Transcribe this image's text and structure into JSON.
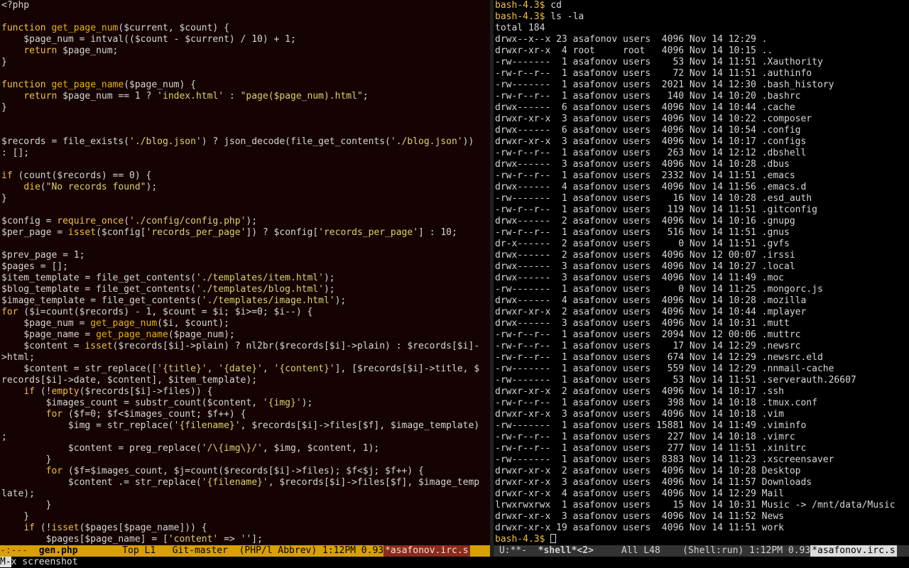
{
  "left_buffer": {
    "lines": [
      "<?php",
      "",
      "function get_page_num($current, $count) {",
      "    $page_num = intval(($count - $current) / 10) + 1;",
      "    return $page_num;",
      "}",
      "",
      "function get_page_name($page_num) {",
      "    return $page_num == 1 ? 'index.html' : \"page($page_num).html\";",
      "}",
      "",
      "",
      "$records = file_exists('./blog.json') ? json_decode(file_get_contents('./blog.json'))",
      ": [];",
      "",
      "if (count($records) == 0) {",
      "    die(\"No records found\");",
      "}",
      "",
      "$config = require_once('./config/config.php');",
      "$per_page = isset($config['records_per_page']) ? $config['records_per_page'] : 10;",
      "",
      "$prev_page = 1;",
      "$pages = [];",
      "$item_template = file_get_contents('./templates/item.html');",
      "$blog_template = file_get_contents('./templates/blog.html');",
      "$image_template = file_get_contents('./templates/image.html');",
      "for ($i=count($records) - 1, $count = $i; $i>=0; $i--) {",
      "    $page_num = get_page_num($i, $count);",
      "    $page_name = get_page_name($page_num);",
      "    $content = isset($records[$i]->plain) ? nl2br($records[$i]->plain) : $records[$i]-",
      ">html;",
      "    $content = str_replace(['{title}', '{date}', '{content}'], [$records[$i]->title, $",
      "records[$i]->date, $content], $item_template);",
      "    if (!empty($records[$i]->files)) {",
      "        $images_count = substr_count($content, '{img}');",
      "        for ($f=0; $f<$images_count; $f++) {",
      "            $img = str_replace('{filename}', $records[$i]->files[$f], $image_template)",
      ";",
      "            $content = preg_replace('/\\{img\\}/', $img, $content, 1);",
      "        }",
      "        for ($f=$images_count, $j=count($records[$i]->files); $f<$j; $f++) {",
      "            $content .= str_replace('{filename}', $records[$i]->files[$f], $image_temp",
      "late);",
      "        }",
      "    }",
      "    if (!isset($pages[$page_name])) {",
      "        $pages[$page_name] = ['content' => ''];"
    ]
  },
  "right_buffer": {
    "lines": [
      "bash-4.3$ cd",
      "bash-4.3$ ls -la",
      "total 184",
      "drwx--x--x 23 asafonov users  4096 Nov 14 12:29 .",
      "drwxr-xr-x  4 root     root   4096 Nov 14 10:15 ..",
      "-rw-------  1 asafonov users    53 Nov 14 11:51 .Xauthority",
      "-rw-r--r--  1 asafonov users    72 Nov 14 11:51 .authinfo",
      "-rw-------  1 asafonov users  2021 Nov 14 12:30 .bash_history",
      "-rw-r--r--  1 asafonov users   140 Nov 14 10:20 .bashrc",
      "drwx------  6 asafonov users  4096 Nov 14 10:44 .cache",
      "drwxr-xr-x  3 asafonov users  4096 Nov 14 10:22 .composer",
      "drwx------  6 asafonov users  4096 Nov 14 10:54 .config",
      "drwxr-xr-x  3 asafonov users  4096 Nov 14 10:17 .configs",
      "-rw-r--r--  1 asafonov users   263 Nov 14 12:12 .dbshell",
      "drwx------  3 asafonov users  4096 Nov 14 10:28 .dbus",
      "-rw-r--r--  1 asafonov users  2332 Nov 14 11:51 .emacs",
      "drwx------  4 asafonov users  4096 Nov 14 11:56 .emacs.d",
      "-rw-------  1 asafonov users    16 Nov 14 10:28 .esd_auth",
      "-rw-r--r--  1 asafonov users   119 Nov 14 11:51 .gitconfig",
      "drwx------  2 asafonov users  4096 Nov 14 10:16 .gnupg",
      "-rw-r--r--  1 asafonov users   516 Nov 14 11:51 .gnus",
      "dr-x------  2 asafonov users     0 Nov 14 11:51 .gvfs",
      "drwx------  2 asafonov users  4096 Nov 12 00:07 .irssi",
      "drwx------  3 asafonov users  4096 Nov 14 10:27 .local",
      "drwx------  3 asafonov users  4096 Nov 14 11:49 .moc",
      "-rw-------  1 asafonov users     0 Nov 14 11:25 .mongorc.js",
      "drwx------  4 asafonov users  4096 Nov 14 10:28 .mozilla",
      "drwxr-xr-x  2 asafonov users  4096 Nov 14 10:44 .mplayer",
      "drwx------  3 asafonov users  4096 Nov 14 10:31 .mutt",
      "-rw-r--r--  1 asafonov users  2094 Nov 12 00:06 .muttrc",
      "-rw-r--r--  1 asafonov users    17 Nov 14 12:29 .newsrc",
      "-rw-r--r--  1 asafonov users   674 Nov 14 12:29 .newsrc.eld",
      "-rw-------  1 asafonov users   559 Nov 14 12:29 .nnmail-cache",
      "-rw-------  1 asafonov users    53 Nov 14 11:51 .serverauth.26607",
      "drwxr-xr-x  2 asafonov users  4096 Nov 14 10:17 .ssh",
      "-rw-r--r--  1 asafonov users   398 Nov 14 10:18 .tmux.conf",
      "drwxr-xr-x  3 asafonov users  4096 Nov 14 10:18 .vim",
      "-rw-------  1 asafonov users 15881 Nov 14 11:49 .viminfo",
      "-rw-r--r--  1 asafonov users   227 Nov 14 10:18 .vimrc",
      "-rw-r--r--  1 asafonov users   277 Nov 14 11:51 .xinitrc",
      "-rw-------  1 asafonov users  8383 Nov 14 11:23 .xscreensaver",
      "drwxr-xr-x  2 asafonov users  4096 Nov 14 10:28 Desktop",
      "drwxr-xr-x  3 asafonov users  4096 Nov 14 11:57 Downloads",
      "drwxr-xr-x  4 asafonov users  4096 Nov 14 12:29 Mail",
      "lrwxrwxrwx  1 asafonov users    15 Nov 14 10:31 Music -> /mnt/data/Music",
      "drwxr-xr-x  3 asafonov users  4096 Nov 14 11:52 News",
      "drwxr-xr-x 19 asafonov users  4096 Nov 14 11:51 work"
    ],
    "final_prompt": "bash-4.3$ "
  },
  "left_modeline": {
    "status": "-:---  ",
    "filename": "gen.php",
    "position": "Top L1",
    "vcs": "Git-master",
    "modes": "(PHP/l Abbrev)",
    "time": "1:12PM 0.93",
    "irc": "*asafonov.irc.s"
  },
  "right_modeline": {
    "status": " U:**-  ",
    "buffer": "*shell*<2>",
    "position": "All L48",
    "modes": "(Shell:run)",
    "time": "1:12PM 0.93",
    "irc": "*asafonov.irc.s"
  },
  "minibuffer": {
    "prefix": "M-",
    "text": "x screenshot"
  },
  "colors": {
    "keyword": "#f0c040",
    "modeline_active": "#d8a000",
    "modeline_inactive": "#333333",
    "left_background": "#150303"
  }
}
